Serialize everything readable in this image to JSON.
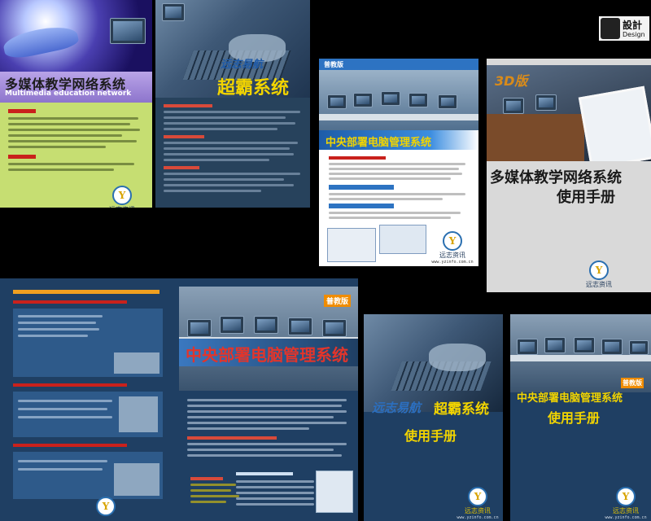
{
  "brand": {
    "name": "远志资讯",
    "url": "www.yzinfo.com.cn",
    "mark": "Y"
  },
  "panel1": {
    "title": "多媒体教学网络系统",
    "subtitle": "Multimedia education network"
  },
  "panel2": {
    "title_prefix": "远志易航",
    "title_main": "超霸系统"
  },
  "panel3": {
    "badge": "普教版",
    "title": "中央部署电脑管理系统"
  },
  "panel4": {
    "stamp_cn": "設計",
    "stamp_en": "Design",
    "badge": "3D版",
    "title": "多媒体教学网络系统",
    "subtitle": "使用手册"
  },
  "panel5": {
    "badge": "普教版",
    "title": "中央部署电脑管理系统"
  },
  "panel6": {
    "title_prefix": "远志易航",
    "title_main": "超霸系统",
    "subtitle": "使用手册"
  },
  "panel7": {
    "badge": "普教版",
    "title": "中央部署电脑管理系统",
    "subtitle": "使用手册"
  },
  "colors": {
    "navy": "#1f3f63",
    "yellow": "#f2d400",
    "red": "#c9211c",
    "lime": "#c9e46a",
    "gray_panel": "#d9d9d9"
  }
}
